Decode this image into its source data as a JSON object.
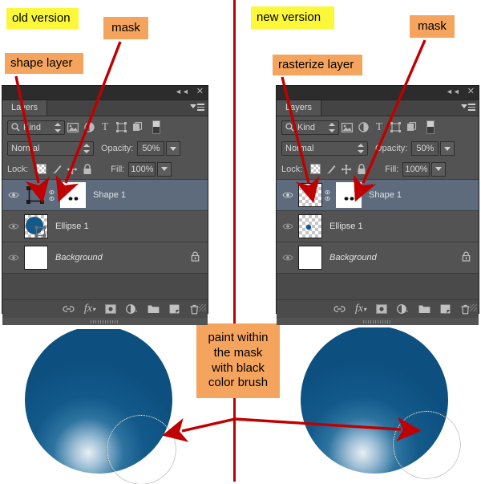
{
  "annotations": {
    "old_version": "old version",
    "new_version": "new version",
    "shape_layer": "shape layer",
    "rasterize_layer": "rasterize layer",
    "mask_left": "mask",
    "mask_right": "mask",
    "center_note": "paint within\nthe mask\nwith black\ncolor brush"
  },
  "colors": {
    "highlight_yellow": "#fbf83a",
    "callout_orange": "#f5a45d",
    "arrow_red": "#c00000",
    "panel_bg": "#535353",
    "selected_row": "#5d6b7d",
    "circle_blue": "#0e5484"
  },
  "panel_left": {
    "tab_label": "Layers",
    "titlebar_icons": [
      "collapse-icon",
      "close-icon"
    ],
    "filter": {
      "kind_label": "Kind",
      "icons": [
        "pixel-filter-icon",
        "adjustment-filter-icon",
        "type-filter-icon",
        "shape-filter-icon",
        "smart-object-filter-icon",
        "filter-toggle-icon"
      ]
    },
    "blend": {
      "mode": "Normal",
      "opacity_label": "Opacity:",
      "opacity_value": "50%"
    },
    "lock": {
      "label": "Lock:",
      "icons": [
        "lock-transparency-icon",
        "lock-image-icon",
        "lock-position-icon",
        "lock-all-icon"
      ],
      "fill_label": "Fill:",
      "fill_value": "100%"
    },
    "layers": [
      {
        "name": "Shape 1",
        "selected": true,
        "italic": false,
        "locked": false,
        "thumb_type": "vector-shape",
        "has_link": true,
        "has_mask": true,
        "mask_type": "raster-mask"
      },
      {
        "name": "Ellipse 1",
        "selected": false,
        "italic": false,
        "locked": false,
        "thumb_type": "blue-circle-vector",
        "has_link": false,
        "has_mask": false,
        "mask_type": ""
      },
      {
        "name": "Background",
        "selected": false,
        "italic": true,
        "locked": true,
        "thumb_type": "white",
        "has_link": false,
        "has_mask": false,
        "mask_type": ""
      }
    ],
    "footer_icons": [
      "link-layers-icon",
      "layer-style-fx-icon",
      "add-mask-icon",
      "adjustment-layer-icon",
      "new-group-icon",
      "new-layer-icon",
      "delete-layer-icon"
    ]
  },
  "panel_right": {
    "tab_label": "Layers",
    "titlebar_icons": [
      "collapse-icon",
      "close-icon"
    ],
    "filter": {
      "kind_label": "Kind",
      "icons": [
        "pixel-filter-icon",
        "adjustment-filter-icon",
        "type-filter-icon",
        "shape-filter-icon",
        "smart-object-filter-icon",
        "filter-toggle-icon"
      ]
    },
    "blend": {
      "mode": "Normal",
      "opacity_label": "Opacity:",
      "opacity_value": "50%"
    },
    "lock": {
      "label": "Lock:",
      "icons": [
        "lock-transparency-icon",
        "lock-image-icon",
        "lock-position-icon",
        "lock-all-icon"
      ],
      "fill_label": "Fill:",
      "fill_value": "100%"
    },
    "layers": [
      {
        "name": "Shape 1",
        "selected": true,
        "italic": false,
        "locked": false,
        "thumb_type": "transparent",
        "has_link": true,
        "has_mask": true,
        "mask_type": "raster-mask"
      },
      {
        "name": "Ellipse 1",
        "selected": false,
        "italic": false,
        "locked": false,
        "thumb_type": "small-blue-dot",
        "has_link": false,
        "has_mask": false,
        "mask_type": ""
      },
      {
        "name": "Background",
        "selected": false,
        "italic": true,
        "locked": true,
        "thumb_type": "white",
        "has_link": false,
        "has_mask": false,
        "mask_type": ""
      }
    ],
    "footer_icons": [
      "link-layers-icon",
      "layer-style-fx-icon",
      "add-mask-icon",
      "adjustment-layer-icon",
      "new-group-icon",
      "new-layer-icon",
      "delete-layer-icon"
    ]
  },
  "artwork": {
    "left_circle": "blue-sphere-left",
    "right_circle": "blue-sphere-right",
    "left_brush_cursor": "brush-cursor-outline",
    "right_brush_cursor": "brush-cursor-outline"
  }
}
